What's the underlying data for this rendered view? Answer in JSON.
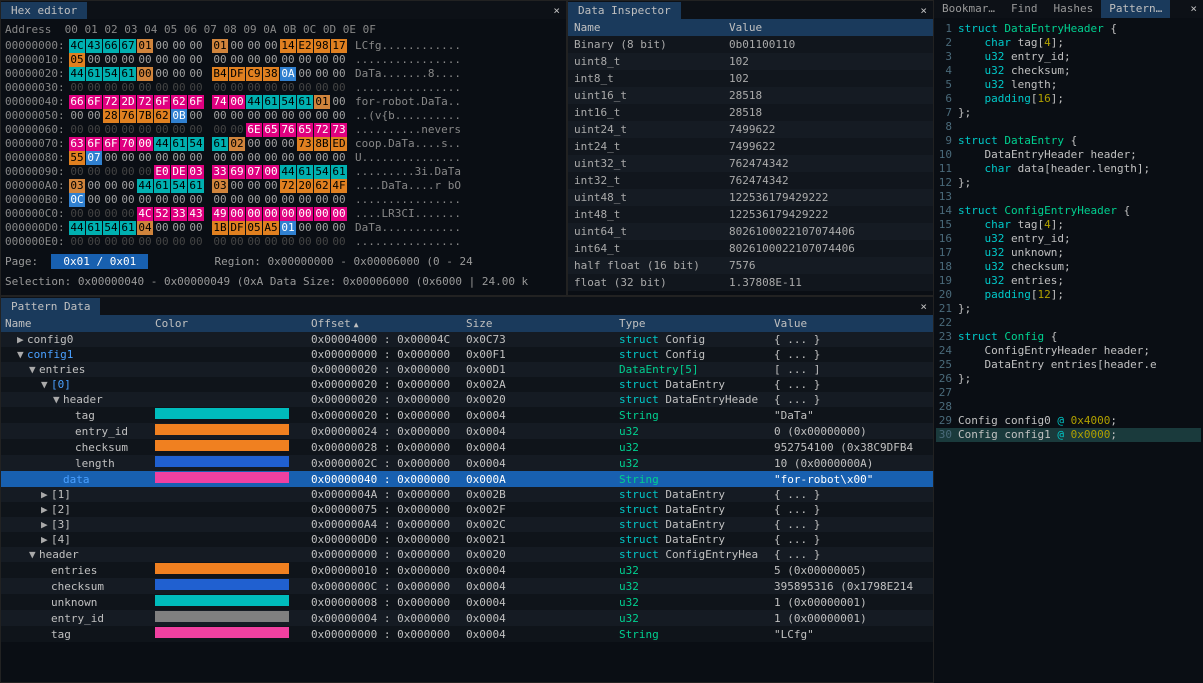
{
  "hex": {
    "title": "Hex editor",
    "address_label": "Address",
    "col_header": "00 01 02 03 04 05 06 07  08 09 0A 0B 0C 0D 0E 0F",
    "rows": [
      {
        "addr": "00000000:",
        "bytes": [
          "4C",
          "43",
          "66",
          "67",
          "01",
          "00",
          "00",
          "00",
          "01",
          "00",
          "00",
          "00",
          "14",
          "E2",
          "98",
          "17"
        ],
        "cls": [
          "b0",
          "b0",
          "b0",
          "b0",
          "b1",
          "",
          "",
          "",
          "b1",
          "",
          "",
          "",
          "b2",
          "b2",
          "b2",
          "b2"
        ],
        "ascii": "LCfg............"
      },
      {
        "addr": "00000010:",
        "bytes": [
          "05",
          "00",
          "00",
          "00",
          "00",
          "00",
          "00",
          "00",
          "00",
          "00",
          "00",
          "00",
          "00",
          "00",
          "00",
          "00"
        ],
        "cls": [
          "b2",
          "",
          "",
          "",
          "",
          "",
          "",
          "",
          "",
          "",
          "",
          "",
          "",
          "",
          "",
          ""
        ],
        "ascii": "................"
      },
      {
        "addr": "00000020:",
        "bytes": [
          "44",
          "61",
          "54",
          "61",
          "00",
          "00",
          "00",
          "00",
          "B4",
          "DF",
          "C9",
          "38",
          "0A",
          "00",
          "00",
          "00"
        ],
        "cls": [
          "b0",
          "b0",
          "b0",
          "b0",
          "b1",
          "",
          "",
          "",
          "b2",
          "b2",
          "b2",
          "b2",
          "b3",
          "",
          "",
          "",
          ""
        ],
        "ascii": "DaTa.......8...."
      },
      {
        "addr": "00000030:",
        "bytes": [
          "00",
          "00",
          "00",
          "00",
          "00",
          "00",
          "00",
          "00",
          "00",
          "00",
          "00",
          "00",
          "00",
          "00",
          "00",
          "00"
        ],
        "cls": [
          "dim",
          "dim",
          "dim",
          "dim",
          "dim",
          "dim",
          "dim",
          "dim",
          "dim",
          "dim",
          "dim",
          "dim",
          "dim",
          "dim",
          "dim",
          "dim"
        ],
        "ascii": "................"
      },
      {
        "addr": "00000040:",
        "bytes": [
          "66",
          "6F",
          "72",
          "2D",
          "72",
          "6F",
          "62",
          "6F",
          "74",
          "00",
          "44",
          "61",
          "54",
          "61",
          "01",
          "00"
        ],
        "cls": [
          "b5",
          "b5",
          "b5",
          "b5",
          "b5",
          "b5",
          "b5",
          "b5",
          "b5",
          "b5",
          "b0",
          "b0",
          "b0",
          "b0",
          "b1",
          ""
        ],
        "ascii": "for-robot.DaTa.."
      },
      {
        "addr": "00000050:",
        "bytes": [
          "00",
          "00",
          "28",
          "76",
          "7B",
          "62",
          "0B",
          "00",
          "00",
          "00",
          "00",
          "00",
          "00",
          "00",
          "00",
          "00"
        ],
        "cls": [
          "",
          "",
          "b2",
          "b2",
          "b2",
          "b2",
          "b3",
          "",
          "",
          "",
          "",
          "",
          "",
          "",
          "",
          ""
        ],
        "ascii": "..(v{b.........."
      },
      {
        "addr": "00000060:",
        "bytes": [
          "00",
          "00",
          "00",
          "00",
          "00",
          "00",
          "00",
          "00",
          "00",
          "00",
          "6E",
          "65",
          "76",
          "65",
          "72",
          "73"
        ],
        "cls": [
          "dim",
          "dim",
          "dim",
          "dim",
          "dim",
          "dim",
          "dim",
          "dim",
          "dim",
          "dim",
          "b5",
          "b5",
          "b5",
          "b5",
          "b5",
          "b5"
        ],
        "ascii": "..........nevers"
      },
      {
        "addr": "00000070:",
        "bytes": [
          "63",
          "6F",
          "6F",
          "70",
          "00",
          "44",
          "61",
          "54",
          "61",
          "02",
          "00",
          "00",
          "00",
          "73",
          "8B",
          "ED"
        ],
        "cls": [
          "b5",
          "b5",
          "b5",
          "b5",
          "b5",
          "b0",
          "b0",
          "b0",
          "b0",
          "b1",
          "",
          "",
          "",
          "b2",
          "b2",
          "b2"
        ],
        "ascii": "coop.DaTa....s.."
      },
      {
        "addr": "00000080:",
        "bytes": [
          "55",
          "07",
          "00",
          "00",
          "00",
          "00",
          "00",
          "00",
          "00",
          "00",
          "00",
          "00",
          "00",
          "00",
          "00",
          "00"
        ],
        "cls": [
          "b2",
          "b3",
          "",
          "",
          "",
          "",
          "",
          "",
          "",
          "",
          "",
          "",
          "",
          "",
          "",
          ""
        ],
        "ascii": "U..............."
      },
      {
        "addr": "00000090:",
        "bytes": [
          "00",
          "00",
          "00",
          "00",
          "00",
          "E0",
          "DE",
          "03",
          "33",
          "69",
          "07",
          "00",
          "44",
          "61",
          "54",
          "61"
        ],
        "cls": [
          "dim",
          "dim",
          "dim",
          "dim",
          "dim",
          "b5",
          "b5",
          "b5",
          "b5",
          "b5",
          "b5",
          "b5",
          "b0",
          "b0",
          "b0",
          "b0"
        ],
        "ascii": ".........3i.DaTa"
      },
      {
        "addr": "000000A0:",
        "bytes": [
          "03",
          "00",
          "00",
          "00",
          "44",
          "61",
          "54",
          "61",
          "03",
          "00",
          "00",
          "00",
          "72",
          "20",
          "62",
          "4F"
        ],
        "cls": [
          "b1",
          "",
          "",
          "",
          "b0",
          "b0",
          "b0",
          "b0",
          "b1",
          "",
          "",
          "",
          "b2",
          "b2",
          "b2",
          "b2"
        ],
        "ascii": "....DaTa....r bO"
      },
      {
        "addr": "000000B0:",
        "bytes": [
          "0C",
          "00",
          "00",
          "00",
          "00",
          "00",
          "00",
          "00",
          "00",
          "00",
          "00",
          "00",
          "00",
          "00",
          "00",
          "00"
        ],
        "cls": [
          "b3",
          "",
          "",
          "",
          "",
          "",
          "",
          "",
          "",
          "",
          "",
          "",
          "",
          "",
          "",
          ""
        ],
        "ascii": "................"
      },
      {
        "addr": "000000C0:",
        "bytes": [
          "00",
          "00",
          "00",
          "00",
          "4C",
          "52",
          "33",
          "43",
          "49",
          "00",
          "00",
          "00",
          "00",
          "00",
          "00",
          "00"
        ],
        "cls": [
          "dim",
          "dim",
          "dim",
          "dim",
          "b5",
          "b5",
          "b5",
          "b5",
          "b5",
          "b5",
          "b5",
          "b5",
          "b5",
          "b5",
          "b5",
          "b5"
        ],
        "ascii": "....LR3CI......."
      },
      {
        "addr": "000000D0:",
        "bytes": [
          "44",
          "61",
          "54",
          "61",
          "04",
          "00",
          "00",
          "00",
          "1B",
          "DF",
          "05",
          "A5",
          "01",
          "00",
          "00",
          "00"
        ],
        "cls": [
          "b0",
          "b0",
          "b0",
          "b0",
          "b1",
          "",
          "",
          "",
          "b2",
          "b2",
          "b2",
          "b2",
          "b3",
          "",
          "",
          "",
          ""
        ],
        "ascii": "DaTa............"
      },
      {
        "addr": "000000E0:",
        "bytes": [
          "00",
          "00",
          "00",
          "00",
          "00",
          "00",
          "00",
          "00",
          "00",
          "00",
          "00",
          "00",
          "00",
          "00",
          "00",
          "00"
        ],
        "cls": [
          "dim",
          "dim",
          "dim",
          "dim",
          "dim",
          "dim",
          "dim",
          "dim",
          "dim",
          "dim",
          "dim",
          "dim",
          "dim",
          "dim",
          "dim",
          "dim"
        ],
        "ascii": "................"
      }
    ],
    "page_label": "Page:",
    "page_indicator": "0x01 / 0x01",
    "region": "Region: 0x00000000 - 0x00006000 (0 - 24",
    "selection": "Selection: 0x00000040 - 0x00000049 (0xA Data Size: 0x00006000 (0x6000 | 24.00 k"
  },
  "inspector": {
    "title": "Data Inspector",
    "head_name": "Name",
    "head_value": "Value",
    "rows": [
      {
        "name": "Binary (8 bit)",
        "value": "0b01100110"
      },
      {
        "name": "uint8_t",
        "value": "102"
      },
      {
        "name": "int8_t",
        "value": "102"
      },
      {
        "name": "uint16_t",
        "value": "28518"
      },
      {
        "name": "int16_t",
        "value": "28518"
      },
      {
        "name": "uint24_t",
        "value": "7499622"
      },
      {
        "name": "int24_t",
        "value": "7499622"
      },
      {
        "name": "uint32_t",
        "value": "762474342"
      },
      {
        "name": "int32_t",
        "value": "762474342"
      },
      {
        "name": "uint48_t",
        "value": "122536179429222"
      },
      {
        "name": "int48_t",
        "value": "122536179429222"
      },
      {
        "name": "uint64_t",
        "value": "8026100022107074406"
      },
      {
        "name": "int64_t",
        "value": "8026100022107074406"
      },
      {
        "name": "half float (16 bit)",
        "value": "7576"
      },
      {
        "name": "float (32 bit)",
        "value": "1.37808E-11"
      }
    ]
  },
  "pattern": {
    "title": "Pattern Data",
    "headers": {
      "name": "Name",
      "color": "Color",
      "offset": "Offset",
      "size": "Size",
      "type": "Type",
      "value": "Value"
    },
    "rows": [
      {
        "i": 1,
        "arrow": "▶",
        "name": "config0",
        "color": "",
        "off": "0x00004000 : 0x00004C",
        "size": "0x0C73",
        "type_kw": "struct ",
        "type": "Config",
        "value": "{ ... }"
      },
      {
        "i": 1,
        "arrow": "▼",
        "name": "config1",
        "color": "",
        "off": "0x00000000 : 0x000000",
        "size": "0x00F1",
        "type_kw": "struct ",
        "type": "Config",
        "value": "{ ... }",
        "blue": true
      },
      {
        "i": 2,
        "arrow": "▼",
        "name": "entries",
        "color": "",
        "off": "0x00000020 : 0x000000",
        "size": "0x00D1",
        "type_kw": "",
        "type": "DataEntry[5]",
        "value": "[ ... ]",
        "ty_green": true
      },
      {
        "i": 3,
        "arrow": "▼",
        "name": "[0]",
        "color": "",
        "off": "0x00000020 : 0x000000",
        "size": "0x002A",
        "type_kw": "struct ",
        "type": "DataEntry",
        "value": "{ ... }",
        "blue": true
      },
      {
        "i": 4,
        "arrow": "▼",
        "name": "header",
        "color": "",
        "off": "0x00000020 : 0x000000",
        "size": "0x0020",
        "type_kw": "struct ",
        "type": "DataEntryHeade",
        "value": "{ ... }"
      },
      {
        "i": 5,
        "arrow": "",
        "name": "tag",
        "color": "cb-teal",
        "off": "0x00000020 : 0x000000",
        "size": "0x0004",
        "type_kw": "",
        "type": "String",
        "value": "\"DaTa\"",
        "ty_green": true
      },
      {
        "i": 5,
        "arrow": "",
        "name": "entry_id",
        "color": "cb-orange",
        "off": "0x00000024 : 0x000000",
        "size": "0x0004",
        "type_kw": "",
        "type": "u32",
        "value": "0 (0x00000000)",
        "ty_green": true
      },
      {
        "i": 5,
        "arrow": "",
        "name": "checksum",
        "color": "cb-orange",
        "off": "0x00000028 : 0x000000",
        "size": "0x0004",
        "type_kw": "",
        "type": "u32",
        "value": "952754100 (0x38C9DFB4",
        "ty_green": true
      },
      {
        "i": 5,
        "arrow": "",
        "name": "length",
        "color": "cb-blue",
        "off": "0x0000002C : 0x000000",
        "size": "0x0004",
        "type_kw": "",
        "type": "u32",
        "value": "10 (0x0000000A)",
        "ty_green": true
      },
      {
        "i": 4,
        "arrow": "",
        "name": "data",
        "color": "cb-pink",
        "off": "0x00000040 : 0x000000",
        "size": "0x000A",
        "type_kw": "",
        "type": "String",
        "value": "\"for-robot\\x00\"",
        "sel": true,
        "ty_green": true
      },
      {
        "i": 3,
        "arrow": "▶",
        "name": "[1]",
        "color": "",
        "off": "0x0000004A : 0x000000",
        "size": "0x002B",
        "type_kw": "struct ",
        "type": "DataEntry",
        "value": "{ ... }"
      },
      {
        "i": 3,
        "arrow": "▶",
        "name": "[2]",
        "color": "",
        "off": "0x00000075 : 0x000000",
        "size": "0x002F",
        "type_kw": "struct ",
        "type": "DataEntry",
        "value": "{ ... }"
      },
      {
        "i": 3,
        "arrow": "▶",
        "name": "[3]",
        "color": "",
        "off": "0x000000A4 : 0x000000",
        "size": "0x002C",
        "type_kw": "struct ",
        "type": "DataEntry",
        "value": "{ ... }"
      },
      {
        "i": 3,
        "arrow": "▶",
        "name": "[4]",
        "color": "",
        "off": "0x000000D0 : 0x000000",
        "size": "0x0021",
        "type_kw": "struct ",
        "type": "DataEntry",
        "value": "{ ... }"
      },
      {
        "i": 2,
        "arrow": "▼",
        "name": "header",
        "color": "",
        "off": "0x00000000 : 0x000000",
        "size": "0x0020",
        "type_kw": "struct ",
        "type": "ConfigEntryHea",
        "value": "{ ... }"
      },
      {
        "i": 3,
        "arrow": "",
        "name": "entries",
        "color": "cb-orange",
        "off": "0x00000010 : 0x000000",
        "size": "0x0004",
        "type_kw": "",
        "type": "u32",
        "value": "5 (0x00000005)",
        "ty_green": true
      },
      {
        "i": 3,
        "arrow": "",
        "name": "checksum",
        "color": "cb-blue",
        "off": "0x0000000C : 0x000000",
        "size": "0x0004",
        "type_kw": "",
        "type": "u32",
        "value": "395895316 (0x1798E214",
        "ty_green": true
      },
      {
        "i": 3,
        "arrow": "",
        "name": "unknown",
        "color": "cb-teal",
        "off": "0x00000008 : 0x000000",
        "size": "0x0004",
        "type_kw": "",
        "type": "u32",
        "value": "1 (0x00000001)",
        "ty_green": true
      },
      {
        "i": 3,
        "arrow": "",
        "name": "entry_id",
        "color": "cb-grey",
        "off": "0x00000004 : 0x000000",
        "size": "0x0004",
        "type_kw": "",
        "type": "u32",
        "value": "1 (0x00000001)",
        "ty_green": true
      },
      {
        "i": 3,
        "arrow": "",
        "name": "tag",
        "color": "cb-pink",
        "off": "0x00000000 : 0x000000",
        "size": "0x0004",
        "type_kw": "",
        "type": "String",
        "value": "\"LCfg\"",
        "ty_green": true
      }
    ]
  },
  "tabs": {
    "bookmarks": "Bookmar…",
    "find": "Find",
    "hashes": "Hashes",
    "pattern": "Pattern…"
  },
  "code": [
    {
      "n": 1,
      "html": "<span class='kw'>struct</span> <span class='ty'>DataEntryHeader</span> {"
    },
    {
      "n": 2,
      "html": "    <span class='kw'>char</span> tag[<span class='num'>4</span>];"
    },
    {
      "n": 3,
      "html": "    <span class='kw'>u32</span> entry_id;"
    },
    {
      "n": 4,
      "html": "    <span class='kw'>u32</span> checksum;"
    },
    {
      "n": 5,
      "html": "    <span class='kw'>u32</span> length;"
    },
    {
      "n": 6,
      "html": "    <span class='kw'>padding</span>[<span class='num'>16</span>];"
    },
    {
      "n": 7,
      "html": "};"
    },
    {
      "n": 8,
      "html": ""
    },
    {
      "n": 9,
      "html": "<span class='kw'>struct</span> <span class='ty'>DataEntry</span> {"
    },
    {
      "n": 10,
      "html": "    DataEntryHeader header;"
    },
    {
      "n": 11,
      "html": "    <span class='kw'>char</span> data[header.length];"
    },
    {
      "n": 12,
      "html": "};"
    },
    {
      "n": 13,
      "html": ""
    },
    {
      "n": 14,
      "html": "<span class='kw'>struct</span> <span class='ty'>ConfigEntryHeader</span> {"
    },
    {
      "n": 15,
      "html": "    <span class='kw'>char</span> tag[<span class='num'>4</span>];"
    },
    {
      "n": 16,
      "html": "    <span class='kw'>u32</span> entry_id;"
    },
    {
      "n": 17,
      "html": "    <span class='kw'>u32</span> unknown;"
    },
    {
      "n": 18,
      "html": "    <span class='kw'>u32</span> checksum;"
    },
    {
      "n": 19,
      "html": "    <span class='kw'>u32</span> entries;"
    },
    {
      "n": 20,
      "html": "    <span class='kw'>padding</span>[<span class='num'>12</span>];"
    },
    {
      "n": 21,
      "html": "};"
    },
    {
      "n": 22,
      "html": ""
    },
    {
      "n": 23,
      "html": "<span class='kw'>struct</span> <span class='ty'>Config</span> {"
    },
    {
      "n": 24,
      "html": "    ConfigEntryHeader header;"
    },
    {
      "n": 25,
      "html": "    DataEntry entries[header.e"
    },
    {
      "n": 26,
      "html": "};"
    },
    {
      "n": 27,
      "html": ""
    },
    {
      "n": 28,
      "html": ""
    },
    {
      "n": 29,
      "html": "Config config0 <span class='kw'>@</span> <span class='num'>0x4000</span>;"
    },
    {
      "n": 30,
      "html": "Config config1 <span class='kw'>@</span> <span class='num'>0x0000</span>;",
      "hl": true
    }
  ]
}
